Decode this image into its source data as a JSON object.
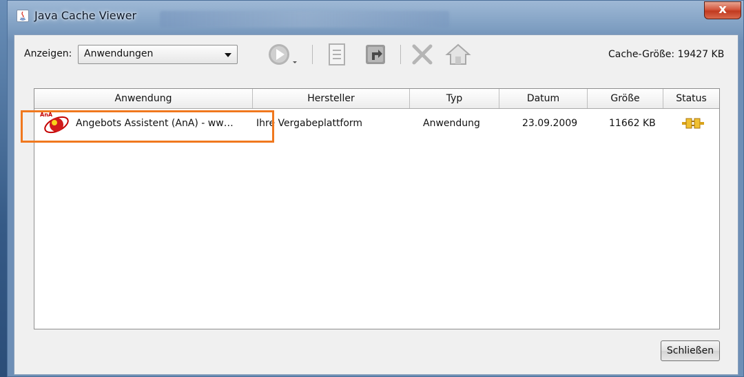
{
  "window": {
    "title": "Java Cache Viewer",
    "close_glyph": "x"
  },
  "toolbar": {
    "show_label": "Anzeigen:",
    "show_value": "Anwendungen",
    "icons": [
      "run-icon",
      "jnlp-icon",
      "shortcut-icon",
      "delete-icon",
      "home-icon"
    ],
    "cache_size_label": "Cache-Größe: 19427 KB"
  },
  "table": {
    "headers": [
      "Anwendung",
      "Hersteller",
      "Typ",
      "Datum",
      "Größe",
      "Status"
    ],
    "rows": [
      {
        "name": "Angebots Assistent (AnA) - ww…",
        "vendor": "Ihre Vergabeplattform",
        "type": "Anwendung",
        "date": "23.09.2009",
        "size": "11662 KB",
        "status_icon": "plug-icon"
      }
    ]
  },
  "footer": {
    "close_label": "Schließen"
  },
  "colors": {
    "highlight": "#f0781e",
    "close": "#c13a20"
  }
}
